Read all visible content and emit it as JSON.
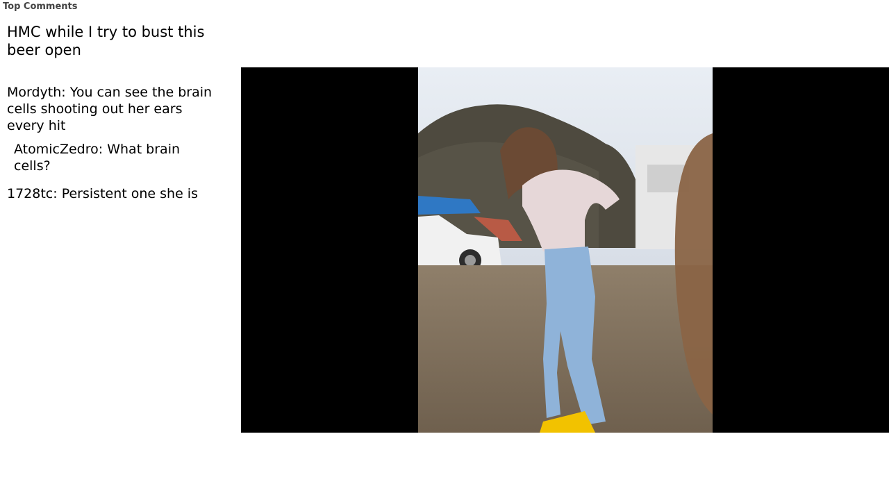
{
  "header": {
    "label": "Top Comments"
  },
  "post": {
    "title": "HMC while I try to bust this beer open"
  },
  "comments": [
    {
      "author": "Mordyth",
      "text": "You can see the brain cells shooting out her ears every hit"
    },
    {
      "author": "AtomicZedro",
      "text": "What brain cells?"
    },
    {
      "author": "1728tc",
      "text": "Persistent one she is"
    }
  ],
  "colors": {
    "background": "#ffffff",
    "video_bg": "#000000"
  }
}
